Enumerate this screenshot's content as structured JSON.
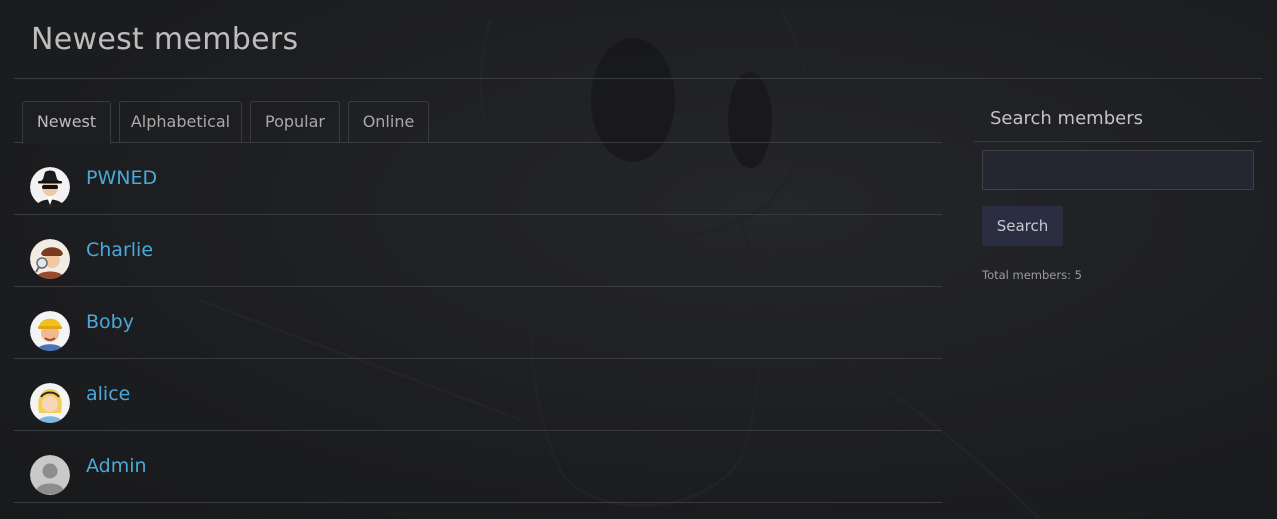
{
  "page": {
    "title": "Newest members"
  },
  "tabs": [
    {
      "label": "Newest",
      "active": true
    },
    {
      "label": "Alphabetical",
      "active": false
    },
    {
      "label": "Popular",
      "active": false
    },
    {
      "label": "Online",
      "active": false
    }
  ],
  "members": [
    {
      "name": "PWNED",
      "avatar": "spy-avatar-icon"
    },
    {
      "name": "Charlie",
      "avatar": "detective-avatar-icon"
    },
    {
      "name": "Boby",
      "avatar": "builder-avatar-icon"
    },
    {
      "name": "alice",
      "avatar": "alice-avatar-icon"
    },
    {
      "name": "Admin",
      "avatar": "default-user-avatar-icon"
    }
  ],
  "sidebar": {
    "title": "Search members",
    "search_value": "",
    "search_button": "Search",
    "total_members": "Total members: 5"
  },
  "colors": {
    "link": "#4aa9d9",
    "border": "#3a3b3f",
    "background": "#1b1c1e",
    "button": "#2b2d40"
  }
}
